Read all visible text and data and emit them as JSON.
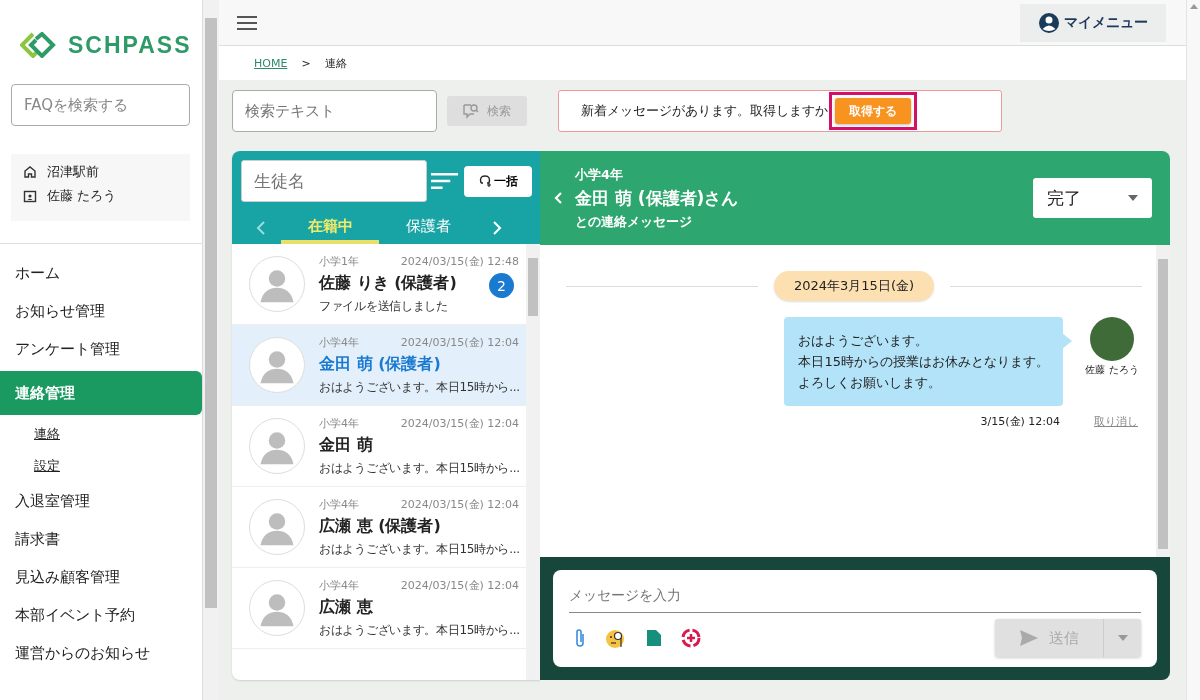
{
  "brand": {
    "name": "SCHPASS"
  },
  "faq_search": {
    "placeholder": "FAQを検索する"
  },
  "school": {
    "name": "沼津駅前",
    "user": "佐藤 たろう"
  },
  "nav": [
    {
      "label": "ホーム",
      "selected": false
    },
    {
      "label": "お知らせ管理",
      "selected": false
    },
    {
      "label": "アンケート管理",
      "selected": false
    },
    {
      "label": "連絡管理",
      "selected": true,
      "children": [
        {
          "label": "連絡"
        },
        {
          "label": "設定"
        }
      ]
    },
    {
      "label": "入退室管理",
      "selected": false
    },
    {
      "label": "請求書",
      "selected": false
    },
    {
      "label": "見込み顧客管理",
      "selected": false
    },
    {
      "label": "本部イベント予約",
      "selected": false
    },
    {
      "label": "運営からのお知らせ",
      "selected": false
    }
  ],
  "topbar": {
    "my_menu": "マイメニュー"
  },
  "breadcrumb": {
    "home": "HOME",
    "separator": ">",
    "current": "連絡"
  },
  "search": {
    "placeholder": "検索テキスト",
    "button": "検索",
    "disabled": true
  },
  "notice": {
    "text": "新着メッセージがあります。取得しますか",
    "button": "取得する",
    "highlighted": true
  },
  "list": {
    "placeholder": "生徒名",
    "bulk_button": "一括",
    "tabs": [
      {
        "label": "在籍中",
        "selected": true
      },
      {
        "label": "保護者",
        "selected": false
      }
    ],
    "contacts": [
      {
        "grade": "小学1年",
        "time": "2024/03/15(金) 12:48",
        "name": "佐藤 りき (保護者)",
        "preview": "ファイルを送信しました",
        "unread": "2",
        "selected": false
      },
      {
        "grade": "小学4年",
        "time": "2024/03/15(金) 12:04",
        "name": "金田 萌 (保護者)",
        "preview": "おはようございます。本日15時から...",
        "selected": true
      },
      {
        "grade": "小学4年",
        "time": "2024/03/15(金) 12:04",
        "name": "金田 萌",
        "preview": "おはようございます。本日15時から...",
        "selected": false
      },
      {
        "grade": "小学4年",
        "time": "2024/03/15(金) 12:04",
        "name": "広瀬 恵 (保護者)",
        "preview": "おはようございます。本日15時から...",
        "selected": false
      },
      {
        "grade": "小学4年",
        "time": "2024/03/15(金) 12:04",
        "name": "広瀬 恵",
        "preview": "おはようございます。本日15時から...",
        "selected": false
      }
    ]
  },
  "chat": {
    "grade": "小学4年",
    "title": "金田 萌 (保護者)さん",
    "subtitle": "との連絡メッセージ",
    "status": "完了",
    "date": "2024年3月15日(金)",
    "messages": [
      {
        "lines": [
          "おはようございます。",
          "本日15時からの授業はお休みとなります。",
          "よろしくお願いします。"
        ],
        "sender": "佐藤 たろう",
        "time": "3/15(金) 12:04",
        "cancel": "取り消し"
      }
    ],
    "composer": {
      "placeholder": "メッセージを入力",
      "send": "送信",
      "send_disabled": true
    }
  }
}
